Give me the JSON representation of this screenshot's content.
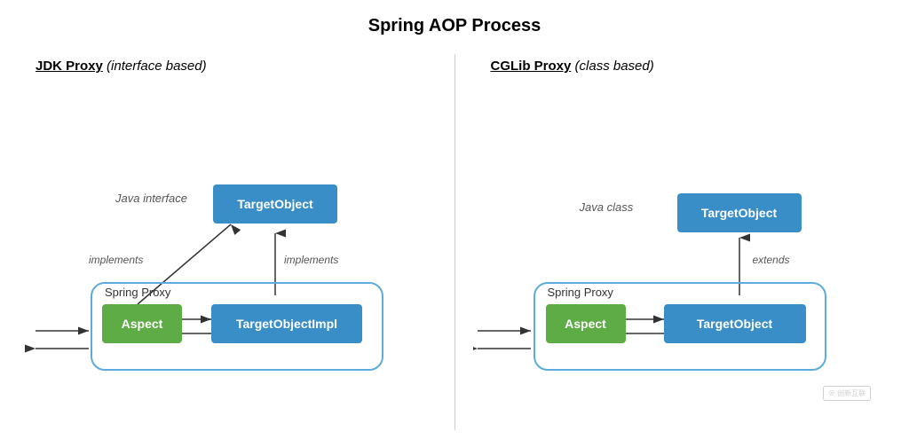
{
  "page": {
    "title": "Spring AOP Process"
  },
  "left_section": {
    "title_underline": "JDK Proxy",
    "title_italic": "(interface based)",
    "target_object_label": "TargetObject",
    "target_object_impl_label": "TargetObjectImpl",
    "aspect_label": "Aspect",
    "spring_proxy_label": "Spring Proxy",
    "java_interface_label": "Java interface",
    "implements_label1": "implements",
    "implements_label2": "implements"
  },
  "right_section": {
    "title_underline": "CGLib Proxy",
    "title_italic": "(class based)",
    "target_object_label": "TargetObject",
    "target_object2_label": "TargetObject",
    "aspect_label": "Aspect",
    "spring_proxy_label": "Spring Proxy",
    "java_class_label": "Java class",
    "extends_label": "extends"
  },
  "colors": {
    "blue": "#3a8ec8",
    "green": "#5dac46",
    "proxy_border": "#5daadc",
    "arrow": "#333"
  }
}
